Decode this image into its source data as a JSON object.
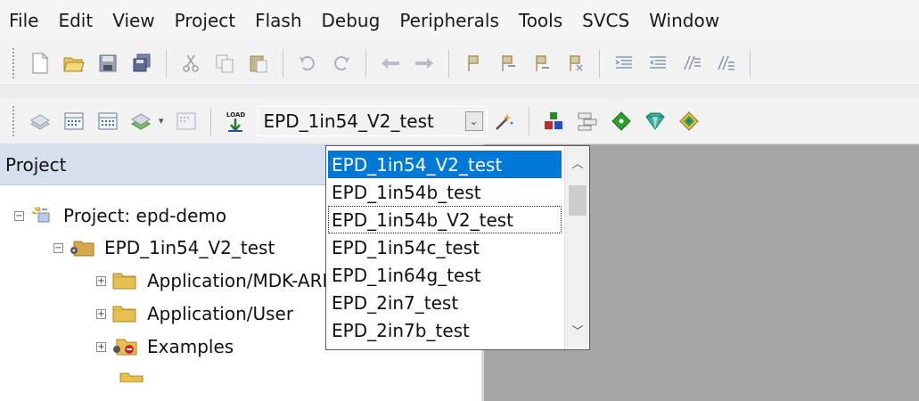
{
  "menu": [
    "File",
    "Edit",
    "View",
    "Project",
    "Flash",
    "Debug",
    "Peripherals",
    "Tools",
    "SVCS",
    "Window"
  ],
  "target_combo": {
    "value": "EPD_1in54_V2_test"
  },
  "project_panel": {
    "title": "Project"
  },
  "tree": {
    "project": "Project: epd-demo",
    "target": "EPD_1in54_V2_test",
    "groups": [
      "Application/MDK-ARM",
      "Application/User",
      "Examples"
    ]
  },
  "dropdown": {
    "items": [
      "EPD_1in54_V2_test",
      "EPD_1in54b_test",
      "EPD_1in54b_V2_test",
      "EPD_1in54c_test",
      "EPD_1in64g_test",
      "EPD_2in7_test",
      "EPD_2in7b_test"
    ],
    "selected": "EPD_1in54_V2_test",
    "focused": "EPD_1in54b_V2_test"
  },
  "colors": {
    "selection": "#0078d7",
    "panel_title": "#d6dfee",
    "editor_bg": "#a6a6a6"
  },
  "icons": {
    "toolbar1": [
      "new-file-icon",
      "open-folder-icon",
      "save-icon",
      "save-all-icon",
      "cut-icon",
      "copy-icon",
      "paste-icon",
      "undo-icon",
      "redo-icon",
      "nav-back-icon",
      "nav-forward-icon",
      "bookmark-icon",
      "bookmark-prev-icon",
      "bookmark-next-icon",
      "bookmark-clear-icon",
      "indent-icon",
      "unindent-icon",
      "comment-icon",
      "uncomment-icon"
    ],
    "toolbar2": [
      "translate-icon",
      "build-icon",
      "rebuild-icon",
      "batch-build-icon",
      "stop-build-icon",
      "load-icon",
      "target-options-icon",
      "manage-components-icon",
      "file-extensions-icon",
      "select-packs-icon",
      "pack-installer-icon",
      "runtime-env-icon"
    ]
  }
}
